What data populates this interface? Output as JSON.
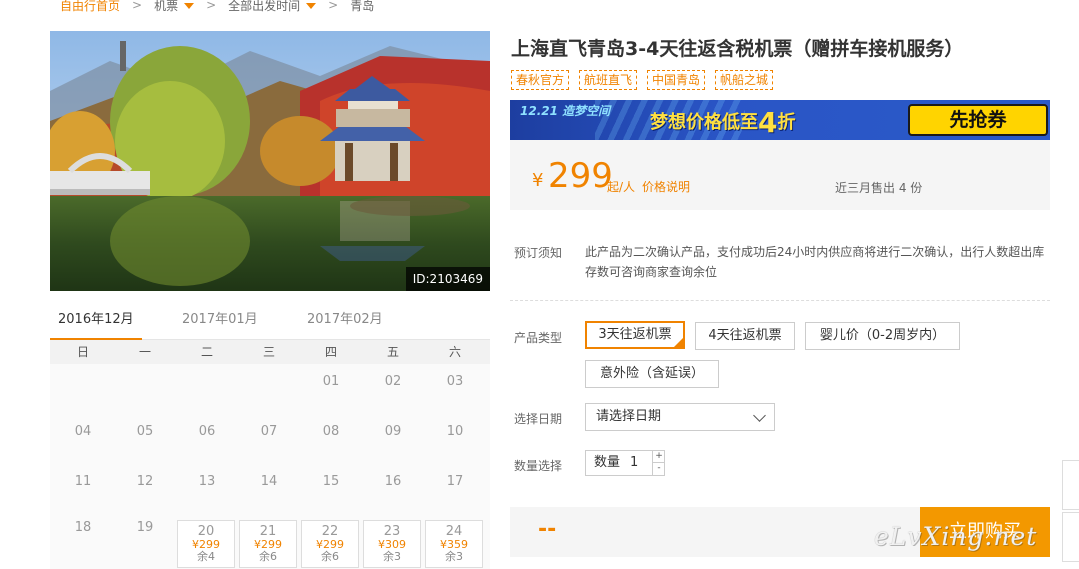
{
  "breadcrumb": {
    "home": "自由行首页",
    "category": "机票",
    "departure": "全部出发时间",
    "destination": "青岛"
  },
  "hero": {
    "image_id": "ID:2103469"
  },
  "calendar": {
    "months": [
      "2016年12月",
      "2017年01月",
      "2017年02月"
    ],
    "active_month": 0,
    "weekdays": [
      "日",
      "一",
      "二",
      "三",
      "四",
      "五",
      "六"
    ],
    "rows": [
      [
        null,
        null,
        null,
        null,
        {
          "d": "01"
        },
        {
          "d": "02"
        },
        {
          "d": "03"
        }
      ],
      [
        {
          "d": "04"
        },
        {
          "d": "05"
        },
        {
          "d": "06"
        },
        {
          "d": "07"
        },
        {
          "d": "08"
        },
        {
          "d": "09"
        },
        {
          "d": "10"
        }
      ],
      [
        {
          "d": "11"
        },
        {
          "d": "12"
        },
        {
          "d": "13"
        },
        {
          "d": "14"
        },
        {
          "d": "15"
        },
        {
          "d": "16"
        },
        {
          "d": "17"
        }
      ],
      [
        {
          "d": "18"
        },
        {
          "d": "19"
        },
        {
          "d": "20",
          "price": "¥299",
          "left": "余4"
        },
        {
          "d": "21",
          "price": "¥299",
          "left": "余6"
        },
        {
          "d": "22",
          "price": "¥299",
          "left": "余6"
        },
        {
          "d": "23",
          "price": "¥309",
          "left": "余3"
        },
        {
          "d": "24",
          "price": "¥359",
          "left": "余3"
        }
      ]
    ]
  },
  "product": {
    "title": "上海直飞青岛3-4天往返含税机票（赠拼车接机服务）",
    "tags": [
      "春秋官方",
      "航班直飞",
      "中国青岛",
      "帆船之城"
    ]
  },
  "banner": {
    "left_text": "12.21 造梦空间",
    "main_text": "梦想价格低至",
    "big_number": "4",
    "suffix": "折",
    "button": "先抢券"
  },
  "price": {
    "currency": "¥",
    "amount": "299",
    "unit": "起/人",
    "explain_link": "价格说明",
    "sold": "近三月售出 4 份"
  },
  "notice": {
    "label": "预订须知",
    "text": "此产品为二次确认产品，支付成功后24小时内供应商将进行二次确认，出行人数超出库存数可咨询商家查询余位"
  },
  "product_type": {
    "label": "产品类型",
    "options": [
      "3天往返机票",
      "4天往返机票",
      "婴儿价（0-2周岁内）",
      "意外险（含延误）"
    ],
    "selected": 0
  },
  "date_select": {
    "label": "选择日期",
    "value": "请选择日期"
  },
  "quantity": {
    "label": "数量选择",
    "field_label": "数量",
    "value": "1",
    "plus": "+",
    "minus": "-"
  },
  "buy": {
    "total": "--",
    "button": "立即购买"
  },
  "watermark": "eLvXing.net",
  "colors": {
    "accent": "#f08300",
    "banner_blue": "#2a55c6",
    "banner_yellow": "#ffd400"
  }
}
